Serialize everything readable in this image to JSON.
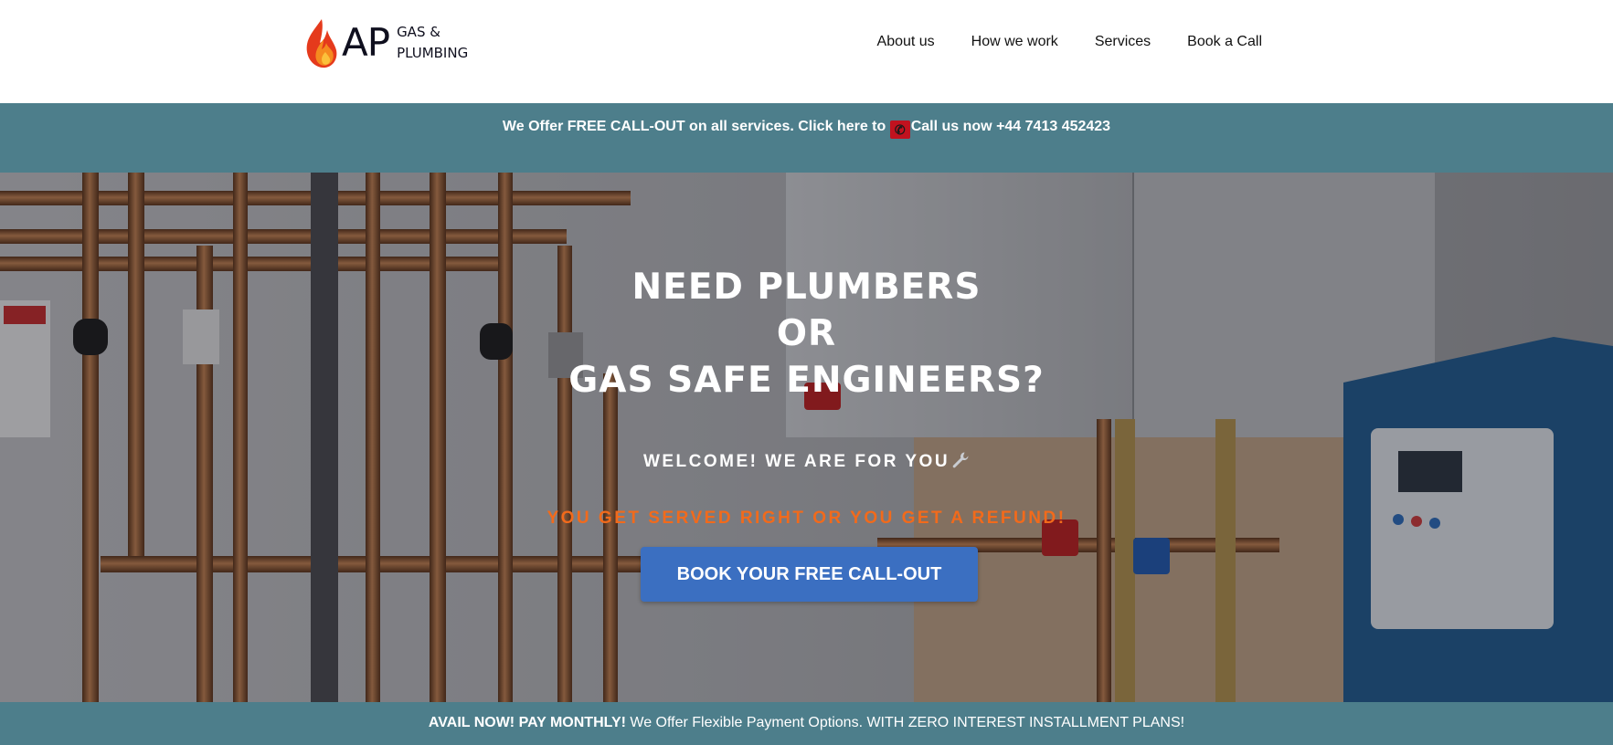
{
  "header": {
    "logo": {
      "mark": "AP",
      "line1": "GAS &",
      "line2": "PLUMBING",
      "icon": "flame-icon"
    },
    "nav": [
      {
        "label": "About us"
      },
      {
        "label": "How we work"
      },
      {
        "label": "Services"
      },
      {
        "label": "Book a Call"
      }
    ]
  },
  "promo": {
    "text_before": "We Offer FREE CALL-OUT on all services. Click here to ",
    "icon": "phone-icon",
    "link_text": "Call us now +44 7413 452423"
  },
  "hero": {
    "title_lines": [
      "NEED PLUMBERS",
      "OR",
      "GAS SAFE ENGINEERS?"
    ],
    "welcome": "WELCOME! WE ARE FOR YOU",
    "welcome_icon": "wrench-icon",
    "refund": "YOU GET SERVED RIGHT OR YOU GET A REFUND!",
    "cta_label": "BOOK YOUR FREE CALL-OUT",
    "background_image": "plumbing-pipes-boiler-photo"
  },
  "bottom_bar": {
    "bold_text": "AVAIL NOW! PAY MONTHLY!",
    "text": " We Offer Flexible Payment Options. WITH ZERO INTEREST INSTALLMENT PLANS!"
  },
  "colors": {
    "bar_teal": "#4d7e8b",
    "cta_blue": "#3b6fc1",
    "refund_orange": "#f26a1b",
    "phone_red": "#c1121f"
  }
}
